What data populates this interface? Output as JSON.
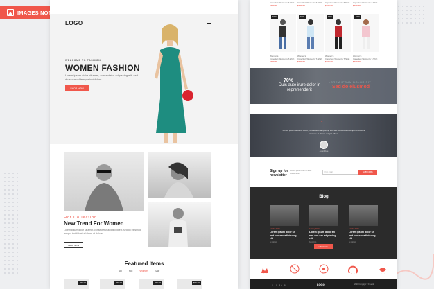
{
  "badge": {
    "label": "IMAGES NOT INCLUDED"
  },
  "hero": {
    "logo": "LOGO",
    "welcome": "WELCOME TO FASHION",
    "title": "WOMEN FASHION",
    "desc": "Lorem ipsum dolor sit amet, consectetur adipiscing elit, sed do eiusmod tempor incididunt",
    "button": "SHOP NOW"
  },
  "collection": {
    "eyebrow": "Hot Collection",
    "title": "New Trend For Women",
    "desc": "Lorem ipsum dolor sit amet, consectetur adipiscing elit, sed do eiusmod tempor incididunt ut labore et dolore",
    "button": "SHOP NOW"
  },
  "featured": {
    "title": "Featured Items",
    "tabs": [
      "All",
      "Hot",
      "Women",
      "Sale"
    ],
    "prices": [
      "$50.00",
      "$50.00",
      "$50.00",
      "$50.00"
    ]
  },
  "products": {
    "top_name": "Imperfect Women's T-Shirt",
    "top_price": "$100.00",
    "badge": "NEW",
    "bottom_label": "Women's"
  },
  "promo": {
    "percent": "70%",
    "line": "Duis aute irure dolor in reprehenderit",
    "right_small": "LOREM IPSUM DOLOR SIT",
    "right_big": "Sed do eiusmod"
  },
  "testimonial": {
    "quote_mark": "“",
    "quote": "Lorem ipsum dolor sit amet, consectetur adipiscing elit, sed do eiusmod tempor incididunt ut labore et dolore magna aliqua.",
    "name": "John Doe"
  },
  "newsletter": {
    "title_1": "Sign up for",
    "title_2": "newsletter",
    "desc": "Lorem ipsum dolor sit amet consectetur",
    "placeholder": "Your email",
    "button": "SUBSCRIBE"
  },
  "blog": {
    "title": "Blog",
    "posts": [
      {
        "date": "12 May 2020",
        "title": "Lorem ipsum dolor sit amt con sec adipiscing elit",
        "by": "by Admin"
      },
      {
        "date": "12 May 2020",
        "title": "Lorem ipsum dolor sit amt con sec adipiscing elit",
        "by": "by Admin"
      },
      {
        "date": "12 May 2020",
        "title": "Lorem ipsum dolor sit amt con sec adipiscing elit",
        "by": "by Admin"
      }
    ],
    "button": "VIEW ALL"
  },
  "brands": [
    "Brand",
    "Brand",
    "Brand",
    "Brand",
    "Brand"
  ],
  "footer": {
    "social": "f t in g+ p",
    "logo": "LOGO",
    "copyright": "2020 Copyright © Freepik"
  },
  "colors": {
    "accent": "#f0574b",
    "dark": "#2b2b2b"
  }
}
